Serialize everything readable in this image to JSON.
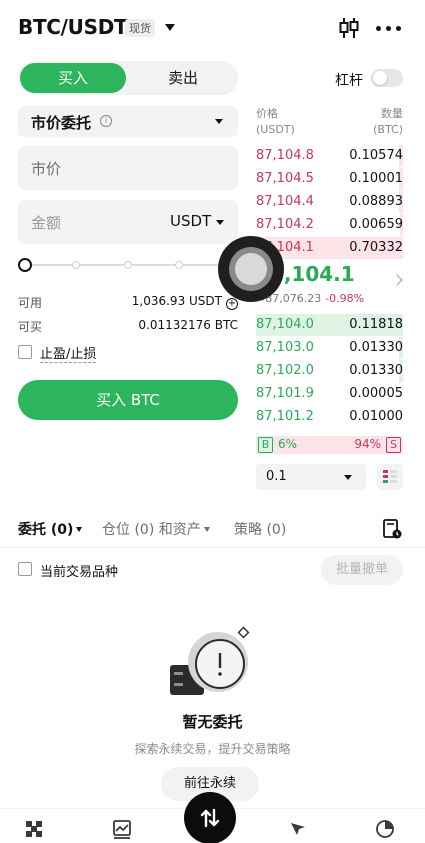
{
  "header": {
    "pair": "BTC/USDT",
    "badge": "现货",
    "icons": [
      "candlestick-icon",
      "more-icon",
      "chevron-down-icon"
    ]
  },
  "trade_form": {
    "buy_tab": "买入",
    "sell_tab": "卖出",
    "leverage_label": "杠杆",
    "leverage_enabled": false,
    "order_type": "市价委托",
    "price_field": "市价",
    "amount_placeholder": "金额",
    "amount_unit": "USDT",
    "slider_percent": 0,
    "available_label": "可用",
    "available_value": "1,036.93 USDT",
    "can_buy_label": "可买",
    "can_buy_value": "0.01132176 BTC",
    "tpsl_label": "止盈/止损",
    "tpsl_checked": false,
    "submit_label": "买入 BTC",
    "accent_color": "#2db55d"
  },
  "order_book": {
    "price_header": "价格",
    "price_unit": "(USDT)",
    "qty_header": "数量",
    "qty_unit": "(BTC)",
    "asks": [
      {
        "price": "87,104.8",
        "qty": "0.10574",
        "depth": 0.03
      },
      {
        "price": "87,104.5",
        "qty": "0.10001",
        "depth": 0.03
      },
      {
        "price": "87,104.4",
        "qty": "0.08893",
        "depth": 0.03
      },
      {
        "price": "87,104.2",
        "qty": "0.00659",
        "depth": 0.02
      },
      {
        "price": "87,104.1",
        "qty": "0.70332",
        "depth": 1.0
      }
    ],
    "last_price": "87,104.1",
    "last_sub": "≈87,076.23",
    "last_change": "-0.98%",
    "bids": [
      {
        "price": "87,104.0",
        "qty": "0.11818",
        "depth": 1.0
      },
      {
        "price": "87,103.0",
        "qty": "0.01330",
        "depth": 0.03
      },
      {
        "price": "87,102.0",
        "qty": "0.01330",
        "depth": 0.03
      },
      {
        "price": "87,101.9",
        "qty": "0.00005",
        "depth": 0.0
      },
      {
        "price": "87,101.2",
        "qty": "0.01000",
        "depth": 0.0
      }
    ],
    "buy_label": "B",
    "buy_ratio": "6%",
    "sell_ratio": "94%",
    "sell_label": "S",
    "depth_step": "0.1",
    "ask_color": "#c5375b",
    "bid_color": "#2aa956"
  },
  "orders_panel": {
    "tab_open": "委托 (0)",
    "tab_positions": "仓位 (0) 和资产",
    "tab_strategy": "策略 (0)",
    "current_pair_label": "当前交易品种",
    "batch_cancel": "批量撤单",
    "empty_title": "暂无委托",
    "empty_sub": "探索永续交易，提升交易策略",
    "goto_button": "前往永续"
  },
  "bottom_nav": {
    "icons": [
      "home-icon",
      "market-icon",
      "trade-icon",
      "discover-icon",
      "assets-icon"
    ]
  }
}
